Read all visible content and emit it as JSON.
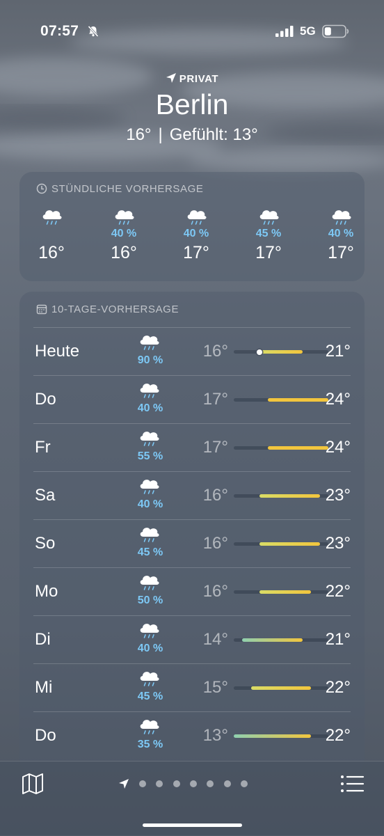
{
  "status_bar": {
    "time": "07:57",
    "network": "5G",
    "icons": [
      "bell-slash-icon",
      "signal-icon",
      "battery-icon"
    ]
  },
  "header": {
    "location_label": "PRIVAT",
    "city": "Berlin",
    "current_temp": "16°",
    "separator": "|",
    "feels_like": "Gefühlt: 13°"
  },
  "hourly": {
    "title": "STÜNDLICHE VORHERSAGE",
    "items": [
      {
        "precip": "",
        "temp": "16°",
        "icon": "rain-cloud-icon"
      },
      {
        "precip": "40 %",
        "temp": "16°",
        "icon": "rain-cloud-icon"
      },
      {
        "precip": "40 %",
        "temp": "17°",
        "icon": "rain-cloud-icon"
      },
      {
        "precip": "45 %",
        "temp": "17°",
        "icon": "rain-cloud-icon"
      },
      {
        "precip": "40 %",
        "temp": "17°",
        "icon": "rain-cloud-icon"
      }
    ]
  },
  "daily": {
    "title": "10-TAGE-VORHERSAGE",
    "range_min": 13,
    "range_max": 24,
    "days": [
      {
        "day": "Heute",
        "precip": "90 %",
        "low": "16°",
        "high": "21°",
        "low_val": 16,
        "high_val": 21,
        "current_val": 16
      },
      {
        "day": "Do",
        "precip": "40 %",
        "low": "17°",
        "high": "24°",
        "low_val": 17,
        "high_val": 24
      },
      {
        "day": "Fr",
        "precip": "55 %",
        "low": "17°",
        "high": "24°",
        "low_val": 17,
        "high_val": 24
      },
      {
        "day": "Sa",
        "precip": "40 %",
        "low": "16°",
        "high": "23°",
        "low_val": 16,
        "high_val": 23
      },
      {
        "day": "So",
        "precip": "45 %",
        "low": "16°",
        "high": "23°",
        "low_val": 16,
        "high_val": 23
      },
      {
        "day": "Mo",
        "precip": "50 %",
        "low": "16°",
        "high": "22°",
        "low_val": 16,
        "high_val": 22
      },
      {
        "day": "Di",
        "precip": "40 %",
        "low": "14°",
        "high": "21°",
        "low_val": 14,
        "high_val": 21
      },
      {
        "day": "Mi",
        "precip": "45 %",
        "low": "15°",
        "high": "22°",
        "low_val": 15,
        "high_val": 22
      },
      {
        "day": "Do",
        "precip": "35 %",
        "low": "13°",
        "high": "22°",
        "low_val": 13,
        "high_val": 22
      }
    ]
  },
  "bottom_bar": {
    "page_count": 8,
    "active_page": 0,
    "icons": [
      "map-icon",
      "location-arrow-icon",
      "list-icon"
    ]
  },
  "colors": {
    "precip_text": "#7dc8f5",
    "bar_cool": "#8fd0b0",
    "bar_mild": "#d9dc66",
    "bar_warm": "#f2c53d"
  }
}
